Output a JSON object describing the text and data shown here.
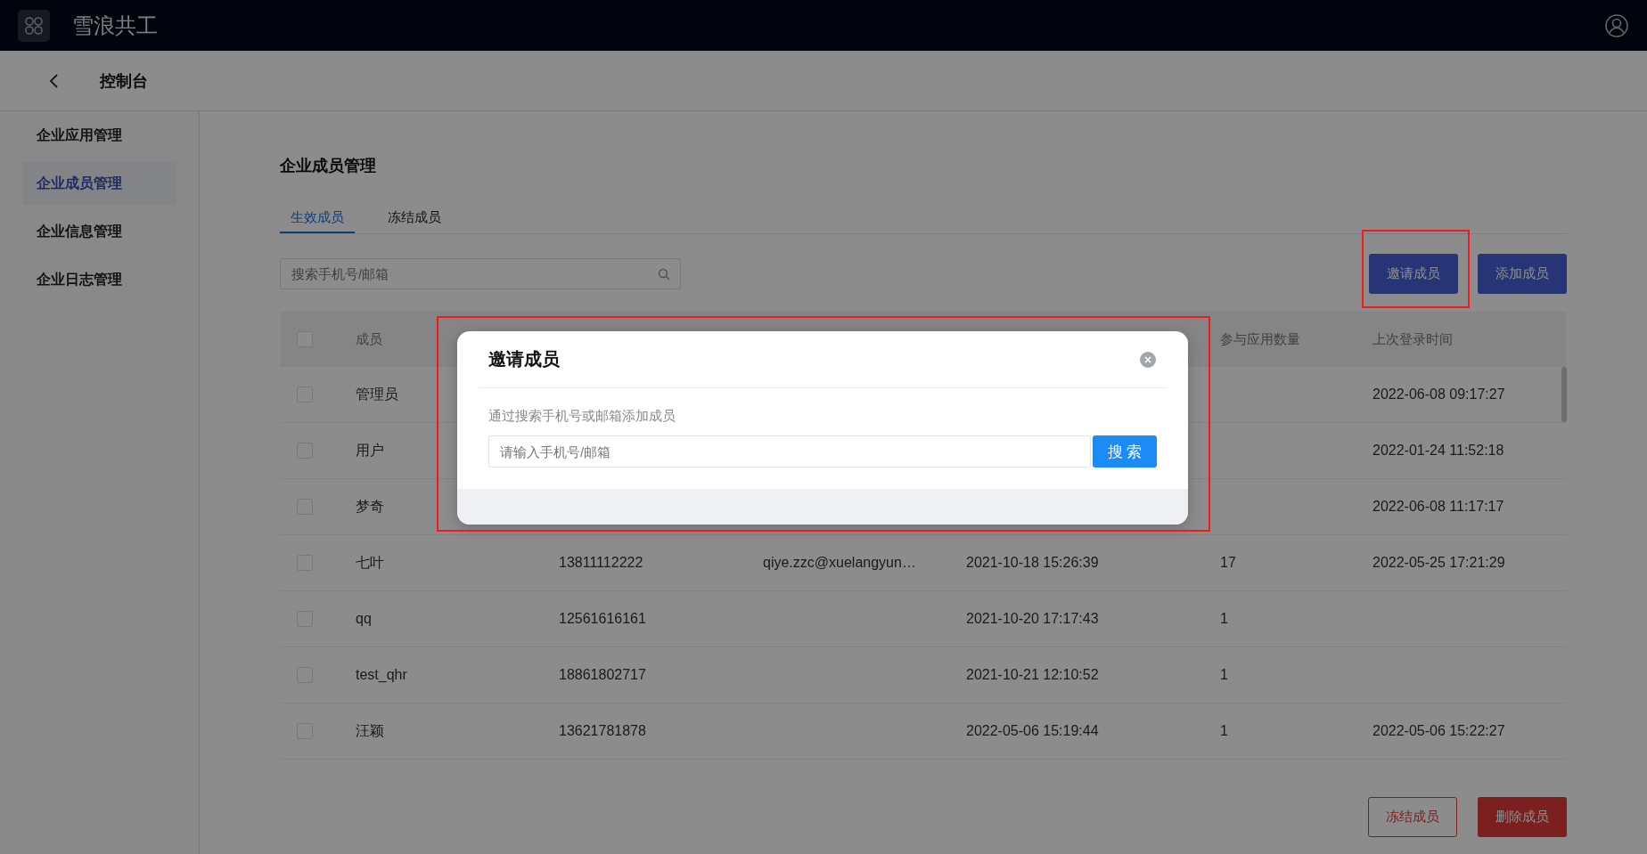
{
  "app": {
    "title": "雪浪共工"
  },
  "nav": {
    "title": "控制台"
  },
  "sidebar": {
    "items": [
      {
        "label": "企业应用管理",
        "selected": false
      },
      {
        "label": "企业成员管理",
        "selected": true
      },
      {
        "label": "企业信息管理",
        "selected": false
      },
      {
        "label": "企业日志管理",
        "selected": false
      }
    ]
  },
  "page": {
    "title": "企业成员管理"
  },
  "tabs": [
    {
      "label": "生效成员",
      "selected": true
    },
    {
      "label": "冻结成员",
      "selected": false
    }
  ],
  "search": {
    "placeholder": "搜索手机号/邮箱"
  },
  "actions": [
    {
      "label": "邀请成员",
      "kind": "primary",
      "highlighted": true
    },
    {
      "label": "添加成员",
      "kind": "primary",
      "highlighted": false
    }
  ],
  "table": {
    "all_checked": false,
    "columns": [
      {
        "label": "成员"
      },
      {},
      {},
      {},
      {
        "label": "参与应用数量"
      },
      {
        "label": "上次登录时间"
      }
    ],
    "rows": [
      {
        "checked": false,
        "cells": [
          "管理员",
          null,
          null,
          null,
          null,
          "2022-06-08 09:17:27"
        ]
      },
      {
        "checked": false,
        "cells": [
          "用户",
          null,
          null,
          null,
          null,
          "2022-01-24 11:52:18"
        ]
      },
      {
        "checked": false,
        "cells": [
          "梦奇",
          null,
          null,
          null,
          null,
          "2022-06-08 11:17:17"
        ]
      },
      {
        "checked": false,
        "cells": [
          "七叶",
          "13811112222",
          "qiye.zzc@xuelangyun…",
          "2021-10-18 15:26:39",
          "17",
          "2022-05-25 17:21:29"
        ]
      },
      {
        "checked": false,
        "cells": [
          "qq",
          "12561616161",
          null,
          "2021-10-20 17:17:43",
          "1",
          null
        ]
      },
      {
        "checked": false,
        "cells": [
          "test_qhr",
          "18861802717",
          null,
          "2021-10-21 12:10:52",
          "1",
          null
        ]
      },
      {
        "checked": false,
        "cells": [
          "汪颖",
          "13621781878",
          null,
          "2022-05-06 15:19:44",
          "1",
          "2022-05-06 15:22:27"
        ]
      }
    ]
  },
  "footer_actions": [
    {
      "label": "冻结成员",
      "kind": "outline-danger"
    },
    {
      "label": "删除成员",
      "kind": "danger"
    }
  ],
  "dialog": {
    "title": "邀请成员",
    "highlighted": true,
    "hint": "通过搜索手机号或邮箱添加成员",
    "input": {
      "placeholder": "请输入手机号/邮箱"
    },
    "button": "搜 索"
  }
}
